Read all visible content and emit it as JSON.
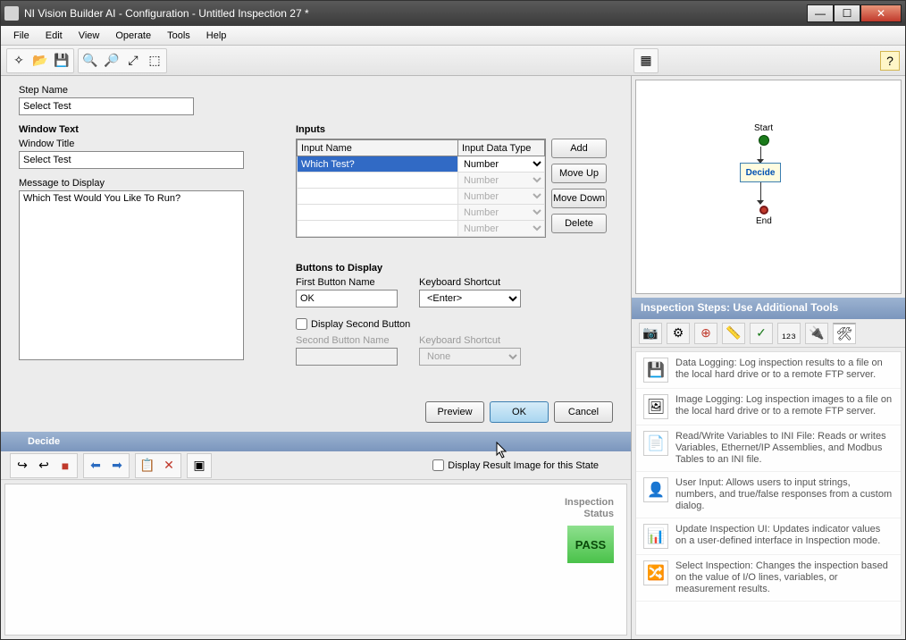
{
  "window": {
    "title": "NI Vision Builder AI - Configuration - Untitled Inspection 27 *"
  },
  "menu": {
    "items": [
      "File",
      "Edit",
      "View",
      "Operate",
      "Tools",
      "Help"
    ]
  },
  "form": {
    "step_name_label": "Step Name",
    "step_name_value": "Select Test",
    "window_text_heading": "Window Text",
    "window_title_label": "Window Title",
    "window_title_value": "Select Test",
    "message_label": "Message to Display",
    "message_value": "Which Test Would You Like To Run?",
    "inputs_heading": "Inputs",
    "inputs_headers": {
      "name": "Input Name",
      "type": "Input Data Type"
    },
    "inputs_rows": [
      {
        "name": "Which Test?",
        "type": "Number",
        "selected": true,
        "enabled": true
      },
      {
        "name": "",
        "type": "Number",
        "enabled": false
      },
      {
        "name": "",
        "type": "Number",
        "enabled": false
      },
      {
        "name": "",
        "type": "Number",
        "enabled": false
      },
      {
        "name": "",
        "type": "Number",
        "enabled": false
      }
    ],
    "inputs_buttons": {
      "add": "Add",
      "up": "Move Up",
      "down": "Move Down",
      "del": "Delete"
    },
    "btd_heading": "Buttons to Display",
    "first_btn_label": "First Button Name",
    "first_btn_value": "OK",
    "kb_shortcut_label": "Keyboard Shortcut",
    "kb_shortcut_value": "<Enter>",
    "display_second_label": "Display Second Button",
    "display_second_checked": false,
    "second_btn_label": "Second Button Name",
    "kb_shortcut2_label": "Keyboard Shortcut",
    "kb_shortcut2_value": "None"
  },
  "dialog": {
    "preview": "Preview",
    "ok": "OK",
    "cancel": "Cancel"
  },
  "state": {
    "header": "Decide",
    "display_result_label": "Display Result Image for this State",
    "inspection_status_label": "Inspection\nStatus",
    "pass": "PASS"
  },
  "flow": {
    "start": "Start",
    "decide": "Decide",
    "end": "End"
  },
  "steps": {
    "header": "Inspection Steps: Use Additional Tools",
    "items": [
      {
        "title": "Data Logging:",
        "desc": "Log inspection results to a file on the local hard drive or to a remote FTP server."
      },
      {
        "title": "Image Logging:",
        "desc": "Log inspection images to a file on the local hard drive or to a remote FTP server."
      },
      {
        "title": "Read/Write Variables to INI File:",
        "desc": "Reads or writes Variables, Ethernet/IP Assemblies, and Modbus Tables to an INI file."
      },
      {
        "title": "User Input:",
        "desc": "Allows users to input strings, numbers, and true/false responses from a custom dialog."
      },
      {
        "title": "Update Inspection UI:",
        "desc": "Updates indicator values on a user-defined interface in Inspection mode."
      },
      {
        "title": "Select Inspection:",
        "desc": "Changes the inspection based on the value of I/O lines, variables, or measurement results."
      }
    ]
  }
}
